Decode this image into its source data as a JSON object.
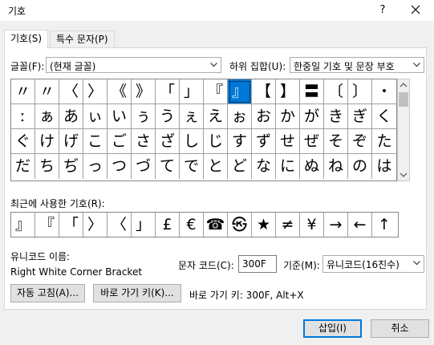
{
  "window": {
    "title": "기호",
    "help": "?",
    "close": "close"
  },
  "tabs": [
    {
      "label": "기호(S)"
    },
    {
      "label": "특수 문자(P)"
    }
  ],
  "font": {
    "label": "글꼴(F):",
    "value": "(현재 글꼴)"
  },
  "subset": {
    "label": "하위 집합(U):",
    "value": "한중일 기호 및 문장 부호"
  },
  "grid": {
    "rows": [
      [
        "〃",
        "〃",
        "〈",
        "〉",
        "《",
        "》",
        "「",
        "」",
        "『",
        "』",
        "【",
        "】",
        "〓",
        "〔",
        "〕",
        "・"
      ],
      [
        "ː",
        "ぁ",
        "あ",
        "ぃ",
        "い",
        "ぅ",
        "う",
        "ぇ",
        "え",
        "ぉ",
        "お",
        "か",
        "が",
        "き",
        "ぎ",
        "く"
      ],
      [
        "ぐ",
        "け",
        "げ",
        "こ",
        "ご",
        "さ",
        "ざ",
        "し",
        "じ",
        "す",
        "ず",
        "せ",
        "ぜ",
        "そ",
        "ぞ",
        "た"
      ],
      [
        "だ",
        "ち",
        "ぢ",
        "っ",
        "つ",
        "づ",
        "て",
        "で",
        "と",
        "ど",
        "な",
        "に",
        "ぬ",
        "ね",
        "の",
        "は"
      ]
    ],
    "selected": [
      0,
      9
    ]
  },
  "recent": {
    "label": "최근에 사용한 기호(R):",
    "symbols": [
      "』",
      "『",
      "「",
      "〉",
      "〈",
      "」",
      "£",
      "€",
      "☎",
      "㉿",
      "★",
      "≠",
      "¥",
      "→",
      "←",
      "↑"
    ]
  },
  "unicode_name": {
    "label": "유니코드 이름:",
    "value": "Right White Corner Bracket"
  },
  "char_code": {
    "label": "문자 코드(C):",
    "value": "300F"
  },
  "from": {
    "label": "기준(M):",
    "value": "유니코드(16진수)"
  },
  "buttons": {
    "autocorrect": "자동 고침(A)...",
    "shortcut": "바로 가기 키(K)...",
    "shortcut_text": "바로 가기 키: 300F, Alt+X",
    "insert": "삽입(I)",
    "cancel": "취소"
  }
}
